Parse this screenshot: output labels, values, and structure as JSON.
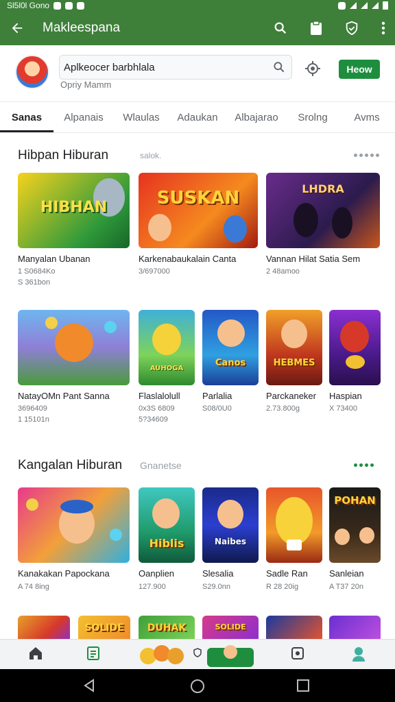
{
  "status_bar": {
    "time": "Sl5l0l Gono"
  },
  "appbar": {
    "title": "Makleespana"
  },
  "header": {
    "search_value": "Aplkeocer barbhlala",
    "subtext": "Opriy Mamm",
    "new_button": "Heow"
  },
  "tabs": [
    "Sanas",
    "Alpanais",
    "Wlaulas",
    "Adaukan",
    "Albajarao",
    "Srolng",
    "Avms"
  ],
  "section1": {
    "title": "Hibpan Hiburan",
    "subtitle": "salok.",
    "row1": [
      {
        "name": "Manyalan Ubanan",
        "meta1": "1 S0684Ko",
        "meta2": "S 361bon",
        "art": "HIBHAN"
      },
      {
        "name": "Karkenabaukalain Canta",
        "meta1": "3/697000",
        "meta2": "",
        "art": "SUSKAN"
      },
      {
        "name": "Vannan Hilat Satia Sem",
        "meta1": "2 48amoo",
        "meta2": "",
        "art": "LHDRA"
      }
    ],
    "row2": [
      {
        "name": "NatayOMn Pant Sanna",
        "meta1": "3696409",
        "meta2": "1 15101n",
        "art": ""
      },
      {
        "name": "Flaslalolull",
        "meta1": "0x3S 6809",
        "meta2": "5?34609",
        "art": "AUHOGA"
      },
      {
        "name": "Parlalia",
        "meta1": "S08/0U0",
        "meta2": "",
        "art": "Canos"
      },
      {
        "name": "Parckaneker",
        "meta1": "2.73.800g",
        "meta2": "",
        "art": "HEBMES"
      },
      {
        "name": "Haspian",
        "meta1": "X 73400",
        "meta2": "",
        "art": ""
      }
    ]
  },
  "section2": {
    "title": "Kangalan Hiburan",
    "subtitle": "Gnanetse",
    "row1": [
      {
        "name": "Kanakakan Papockana",
        "meta1": "A 74 8ing",
        "art": ""
      },
      {
        "name": "Oanplien",
        "meta1": "127.900",
        "art": "Hiblis"
      },
      {
        "name": "Slesalia",
        "meta1": "S29.0nn",
        "art": "Naibes"
      },
      {
        "name": "Sadle Ran",
        "meta1": "R 28 20ig",
        "art": ""
      },
      {
        "name": "Sanleian",
        "meta1": "A T37 20n",
        "art": "POHAN"
      }
    ],
    "row2": [
      {
        "name": "",
        "art": ""
      },
      {
        "name": "",
        "art": "SOLIDE"
      },
      {
        "name": "",
        "art": "DUHAK"
      },
      {
        "name": "",
        "art": "SOLIDE"
      },
      {
        "name": "",
        "art": ""
      },
      {
        "name": "",
        "art": ""
      }
    ]
  },
  "colors": {
    "brand": "#3e7f3a",
    "accent": "#1e8e3e"
  }
}
